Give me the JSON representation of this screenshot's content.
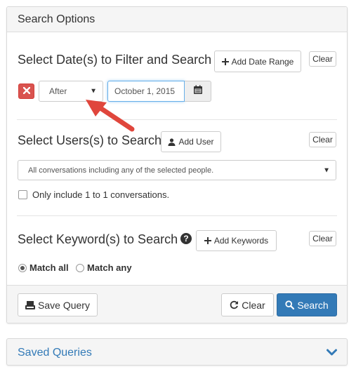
{
  "panel": {
    "title": "Search Options"
  },
  "dates": {
    "title": "Select Date(s) to Filter and Search",
    "add_label": "Add Date Range",
    "clear_label": "Clear",
    "condition": "After",
    "date_value": "October 1, 2015"
  },
  "users": {
    "title": "Select Users(s) to Search",
    "add_label": "Add User",
    "clear_label": "Clear",
    "select_value": "All conversations including any of the selected people.",
    "checkbox_label": "Only include 1 to 1 conversations."
  },
  "keywords": {
    "title": "Select Keyword(s) to Search",
    "add_label": "Add Keywords",
    "clear_label": "Clear",
    "match_all": "Match all",
    "match_any": "Match any",
    "selected_match": "Match all"
  },
  "footer": {
    "save_label": "Save Query",
    "clear_label": "Clear",
    "search_label": "Search"
  },
  "saved": {
    "title": "Saved Queries"
  },
  "colors": {
    "primary": "#337ab7",
    "danger": "#d9534f",
    "annotation_arrow": "#e0463c"
  },
  "icons": {
    "add": "plus-icon",
    "remove": "x-icon",
    "calendar": "calendar-icon",
    "user": "user-icon",
    "help": "question-circle-icon",
    "save": "save-icon",
    "refresh": "refresh-icon",
    "search": "search-icon",
    "expand": "chevron-down-icon"
  }
}
